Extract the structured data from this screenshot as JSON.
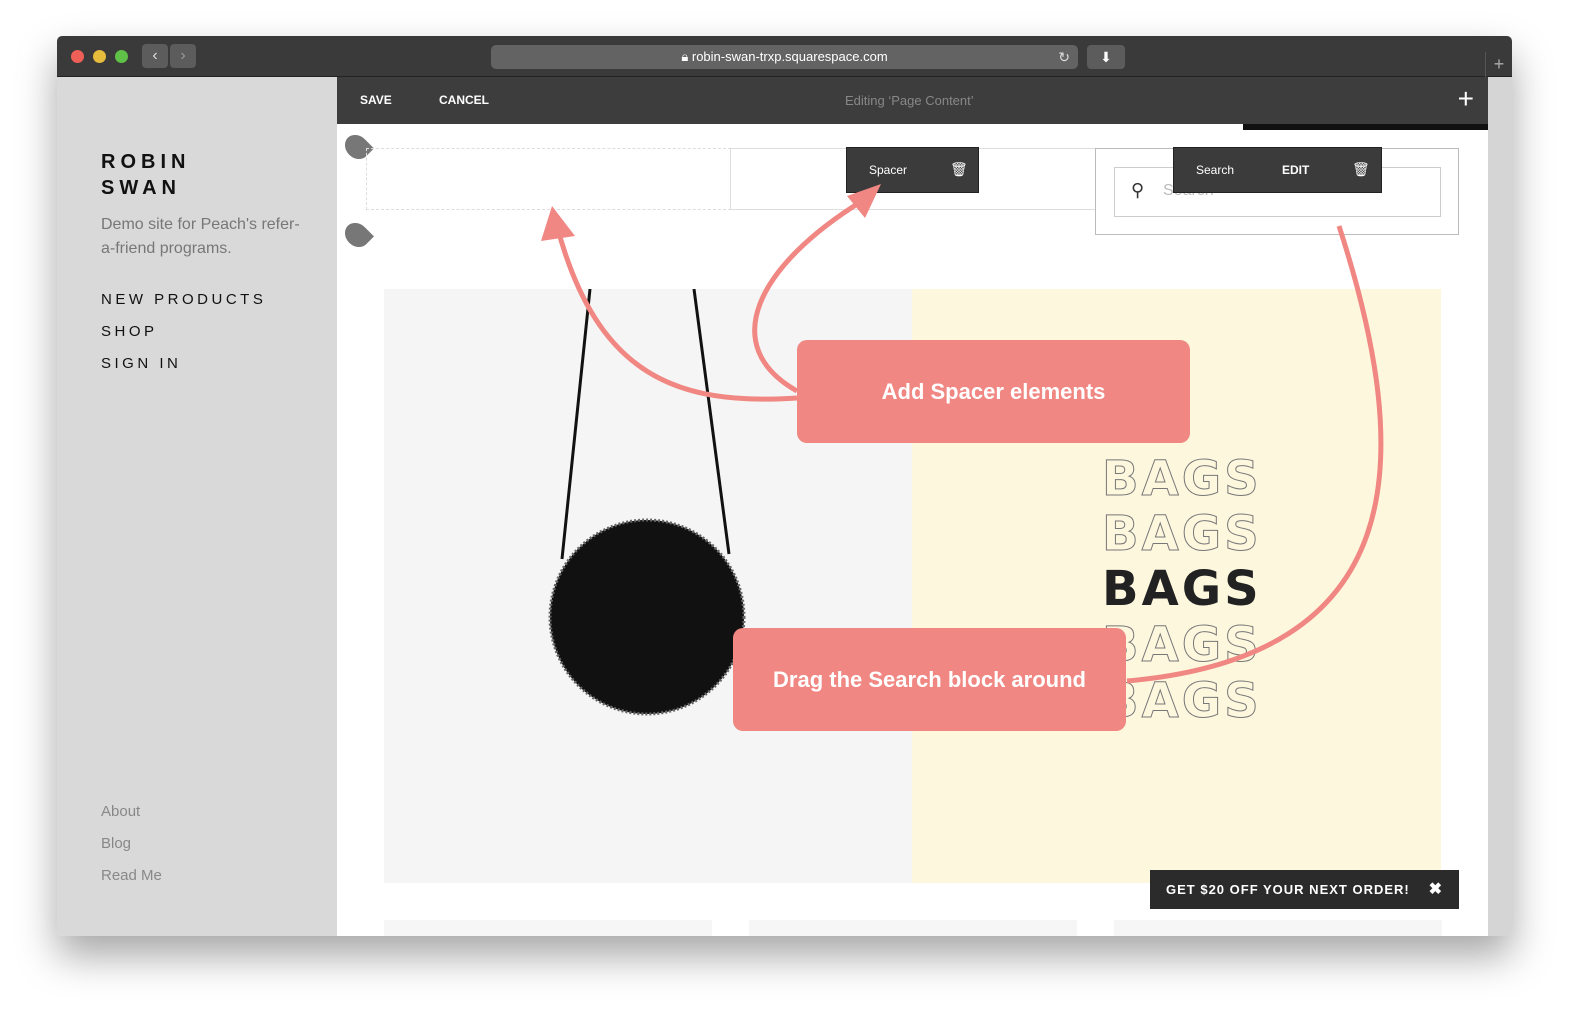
{
  "browser": {
    "url": "robin-swan-trxp.squarespace.com",
    "back_icon": "chevron-left",
    "forward_icon": "chevron-right",
    "reload_icon": "reload",
    "download_icon": "download",
    "new_tab": "+"
  },
  "toolbar": {
    "save": "SAVE",
    "cancel": "CANCEL",
    "editing": "Editing ‘Page Content’",
    "add": "+"
  },
  "sidebar": {
    "brand": "ROBIN SWAN",
    "description": "Demo site for Peach's refer-a-friend programs.",
    "nav": [
      "NEW PRODUCTS",
      "SHOP",
      "SIGN IN"
    ],
    "footer": [
      "About",
      "Blog",
      "Read Me"
    ]
  },
  "blocks": {
    "spacer_label": "Spacer",
    "search_label": "Search",
    "edit_label": "EDIT",
    "search_placeholder": "Search"
  },
  "hero": {
    "words": [
      "BAGS",
      "BAGS",
      "BAGS",
      "BAGS",
      "BAGS"
    ]
  },
  "callouts": {
    "spacer": "Add Spacer elements",
    "search": "Drag the Search block around"
  },
  "promo": {
    "text": "GET $20 OFF YOUR NEXT ORDER!",
    "close": "✖"
  },
  "colors": {
    "accent": "#f08782",
    "toolbar": "#3d3d3d",
    "sidebar": "#d9d9d9",
    "cream": "#fdf7de"
  }
}
